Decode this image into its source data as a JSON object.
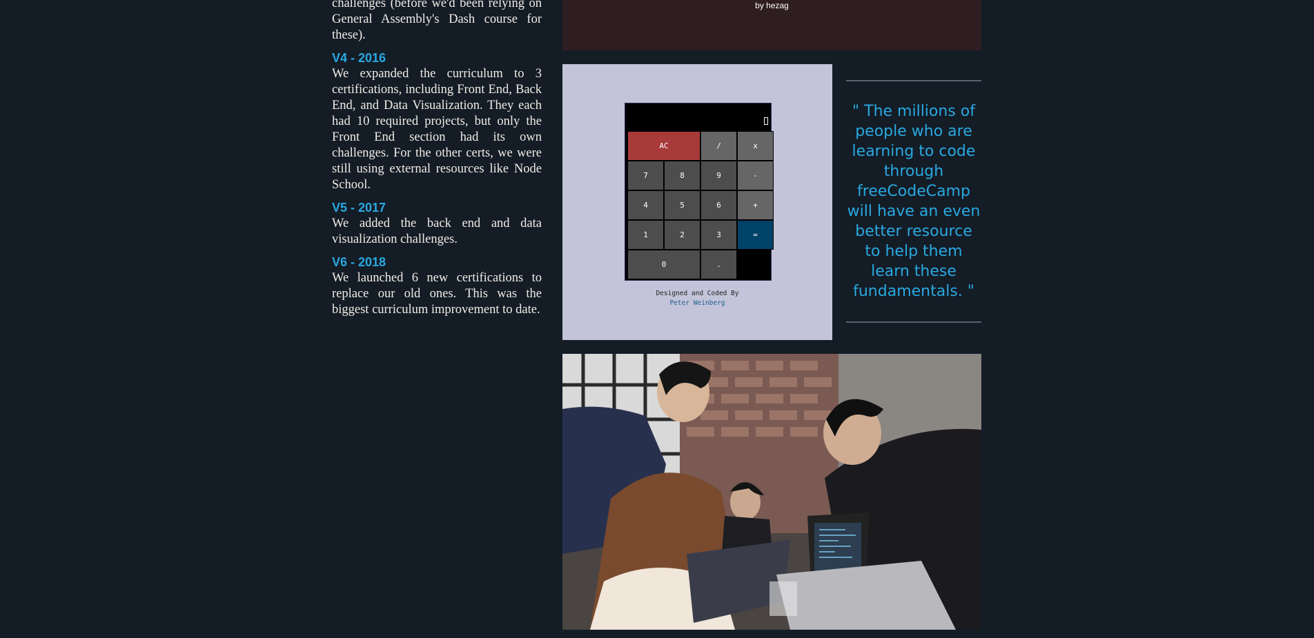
{
  "history": {
    "intro_tail": "challenges (before we'd been relying on General Assembly's Dash course for these).",
    "sections": [
      {
        "heading": "V4 - 2016",
        "body": "We expanded the curriculum to 3 certifications, including Front End, Back End, and Data Visualization. They each had 10 required projects, but only the Front End section had its own challenges. For the other certs, we were still using external resources like Node School."
      },
      {
        "heading": "V5 - 2017",
        "body": "We added the back end and data visualization challenges."
      },
      {
        "heading": "V6 - 2018",
        "body": "We launched 6 new certifications to replace our old ones. This was the biggest curriculum improvement to date."
      }
    ]
  },
  "top_panel": {
    "credit": "by hezag"
  },
  "calculator": {
    "keys": {
      "clear": "AC",
      "divide": "/",
      "multiply": "x",
      "seven": "7",
      "eight": "8",
      "nine": "9",
      "minus": "-",
      "four": "4",
      "five": "5",
      "six": "6",
      "plus": "+",
      "one": "1",
      "two": "2",
      "three": "3",
      "equals": "=",
      "zero": "0",
      "decimal": "."
    },
    "credit_line": "Designed and Coded By",
    "author": "Peter Weinberg"
  },
  "quote": {
    "text": "\" The millions of people who are learning to code through freeCodeCamp will have an even better resource to help them learn these fundamentals. \""
  },
  "colors": {
    "background": "#141c26",
    "accent": "#29a9e0",
    "top_panel": "#2f1e21",
    "calc_panel": "#c3c4d9",
    "clear_key": "#a83a3a",
    "equals_key": "#004268"
  }
}
